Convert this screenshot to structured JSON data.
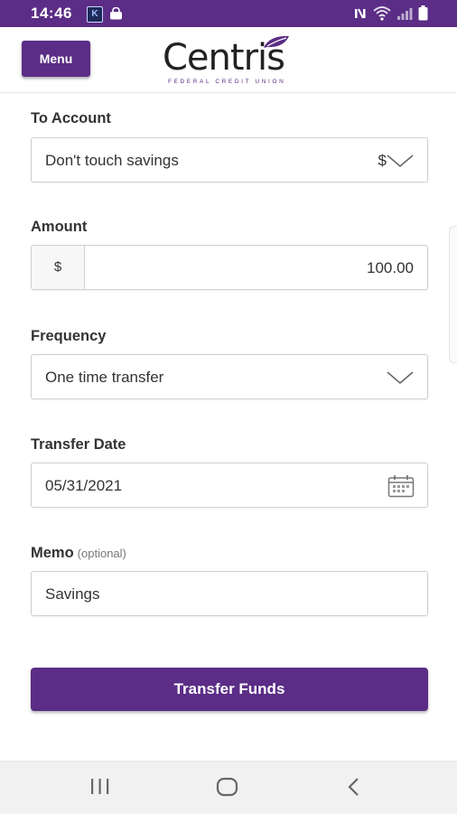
{
  "status_bar": {
    "time": "14:46",
    "app_icon_letter": "K"
  },
  "header": {
    "menu_label": "Menu",
    "logo_name": "Centris",
    "logo_subtitle": "FEDERAL CREDIT UNION",
    "brand_color": "#5b2d86"
  },
  "form": {
    "to_account": {
      "label": "To Account",
      "value": "Don't touch savings",
      "suffix": "$"
    },
    "amount": {
      "label": "Amount",
      "prefix": "$",
      "value": "100.00"
    },
    "frequency": {
      "label": "Frequency",
      "value": "One time transfer"
    },
    "transfer_date": {
      "label": "Transfer Date",
      "value": "05/31/2021"
    },
    "memo": {
      "label": "Memo",
      "optional": "(optional)",
      "value": "Savings"
    },
    "submit_label": "Transfer Funds"
  },
  "icons": {
    "status": [
      "k-app-icon",
      "bag-icon",
      "mute-icon",
      "wifi-icon",
      "signal-icon",
      "battery-icon"
    ],
    "nav": [
      "recent-apps-icon",
      "home-icon",
      "back-icon"
    ]
  }
}
